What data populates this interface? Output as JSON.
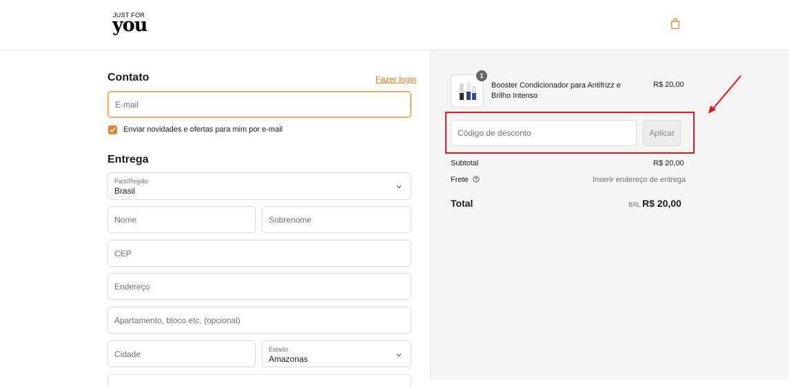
{
  "header": {
    "logo_top": "JUST FOR",
    "logo_main": "you",
    "cart_icon": "shopping-bag-icon"
  },
  "contact": {
    "title": "Contato",
    "login_link": "Fazer login",
    "email_placeholder": "E-mail",
    "newsletter_label": "Enviar novidades e ofertas para mim por e-mail",
    "newsletter_checked": true
  },
  "delivery": {
    "title": "Entrega",
    "country_label": "País/Região",
    "country_value": "Brasil",
    "first_name_placeholder": "Nome",
    "last_name_placeholder": "Sobrenome",
    "cep_placeholder": "CEP",
    "address_placeholder": "Endereço",
    "apartment_placeholder": "Apartamento, bloco etc. (opcional)",
    "city_placeholder": "Cidade",
    "state_label": "Estado",
    "state_value": "Amazonas"
  },
  "order": {
    "item": {
      "quantity": "1",
      "name": "Booster Condicionador para Antifrizz e Brilho Intenso",
      "price": "R$ 20,00"
    },
    "discount_placeholder": "Código de desconto",
    "apply_label": "Aplicar",
    "subtotal_label": "Subtotal",
    "subtotal_value": "R$ 20,00",
    "shipping_label": "Frete",
    "shipping_value": "Inserir endereço de entrega",
    "total_label": "Total",
    "total_currency": "BRL",
    "total_value": "R$ 20,00"
  },
  "colors": {
    "accent": "#e97f2f",
    "highlight": "#e3131b"
  }
}
